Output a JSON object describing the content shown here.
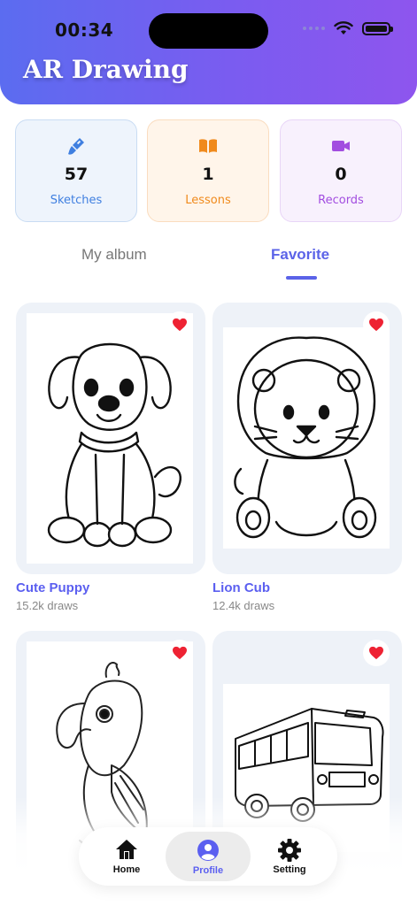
{
  "status_bar": {
    "time": "00:34"
  },
  "header": {
    "title": "AR Drawing"
  },
  "stats": [
    {
      "value": "57",
      "label": "Sketches",
      "icon": "brush-icon",
      "color": "#3f7fe0"
    },
    {
      "value": "1",
      "label": "Lessons",
      "icon": "book-icon",
      "color": "#f08a1c"
    },
    {
      "value": "0",
      "label": "Records",
      "icon": "video-icon",
      "color": "#a24de0"
    }
  ],
  "tabs": {
    "album": "My album",
    "favorite": "Favorite",
    "active": "favorite"
  },
  "items": [
    {
      "title": "Cute Puppy",
      "draws": "15.2k draws",
      "favorited": true
    },
    {
      "title": "Lion Cub",
      "draws": "12.4k draws",
      "favorited": true
    },
    {
      "title": "",
      "draws": "",
      "favorited": true
    },
    {
      "title": "",
      "draws": "",
      "favorited": true
    }
  ],
  "nav": {
    "home": "Home",
    "profile": "Profile",
    "setting": "Setting",
    "active": "profile",
    "accent": "#5b5ff0"
  }
}
